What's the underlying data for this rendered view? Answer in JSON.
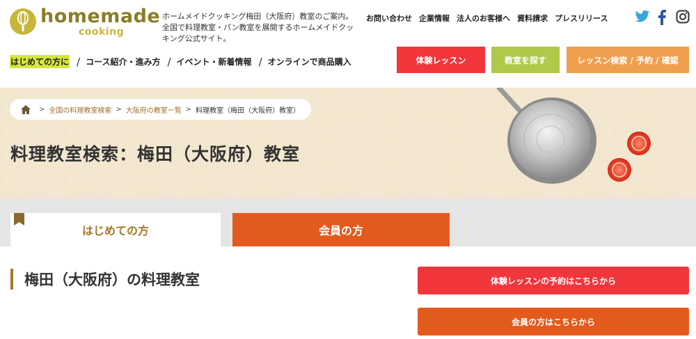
{
  "logo": {
    "brand": "homemade",
    "sub": "cooking"
  },
  "header": {
    "intro": "ホームメイドクッキング梅田（大阪府）教室のご案内。全国で料理教室・パン教室を展開するホームメイドクッキング公式サイト。",
    "util_links": [
      "お問い合わせ",
      "企業情報",
      "法人のお客様へ",
      "資料請求",
      "プレスリリース"
    ],
    "social": [
      "twitter-icon",
      "facebook-icon",
      "instagram-icon"
    ],
    "nav": [
      "はじめての方に",
      "コース紹介・進み方",
      "イベント・新着情報",
      "オンラインで商品購入"
    ],
    "nav_sep": "/",
    "buttons": {
      "trial": "体験レッスン",
      "find": "教室を探す",
      "search": "レッスン検索 / 予約 / 確認"
    }
  },
  "hero": {
    "breadcrumbs": [
      "全国の料理教室検索",
      "大阪府の教室一覧",
      "料理教室（梅田（大阪府）教室）"
    ],
    "crumb_sep": ">",
    "title": "料理教室検索：梅田（大阪府）教室"
  },
  "tabs": {
    "first": "はじめての方",
    "member": "会員の方"
  },
  "main": {
    "section_title": "梅田（大阪府）の料理教室",
    "reserve_button": "体験レッスンの予約はこちらから",
    "member_button": "会員の方はこちらから"
  },
  "colors": {
    "brand_olive": "#8a7d2a",
    "trial_red": "#f1363c",
    "find_green": "#afc94a",
    "search_orange": "#efa04e",
    "member_orange": "#e35a1d",
    "accent_brown": "#a4782c",
    "nav_highlight": "#d6e63a"
  }
}
